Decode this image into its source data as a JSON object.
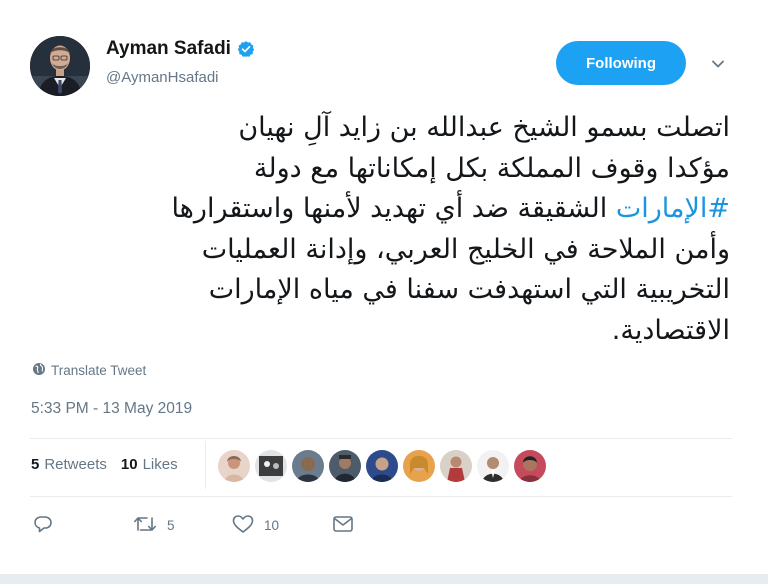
{
  "author": {
    "name": "Ayman Safadi",
    "handle": "@AymanHsafadi",
    "verified": true
  },
  "follow_button": {
    "label": "Following"
  },
  "tweet": {
    "lines": [
      "اتصلت بسمو الشيخ عبدالله بن زايد آلِ نهيان",
      "مؤكدا وقوف المملكة بكل إمكاناتها مع دولة",
      "الشقيقة ضد أي تهديد لأمنها واستقرارها",
      "وأمن الملاحة في الخليج العربي، وإدانة العمليات",
      "التخريبية التي استهدفت سفنا في مياه الإمارات",
      "الاقتصادية."
    ],
    "hashtag": "#الإمارات"
  },
  "translate": {
    "label": "Translate Tweet"
  },
  "timestamp": "5:33 PM - 13 May 2019",
  "stats": {
    "retweets_count": "5",
    "retweets_label": "Retweets",
    "likes_count": "10",
    "likes_label": "Likes"
  },
  "actions": {
    "reply_count": "",
    "retweet_count": "5",
    "like_count": "10"
  },
  "icons": {
    "verified": "verified-badge-icon",
    "caret": "chevron-down-icon",
    "globe": "globe-icon",
    "reply": "reply-icon",
    "retweet": "retweet-icon",
    "like": "heart-icon",
    "dm": "envelope-icon"
  },
  "colors": {
    "accent": "#1da1f2",
    "link": "#1b95e0",
    "muted": "#657786",
    "text": "#14171a"
  }
}
